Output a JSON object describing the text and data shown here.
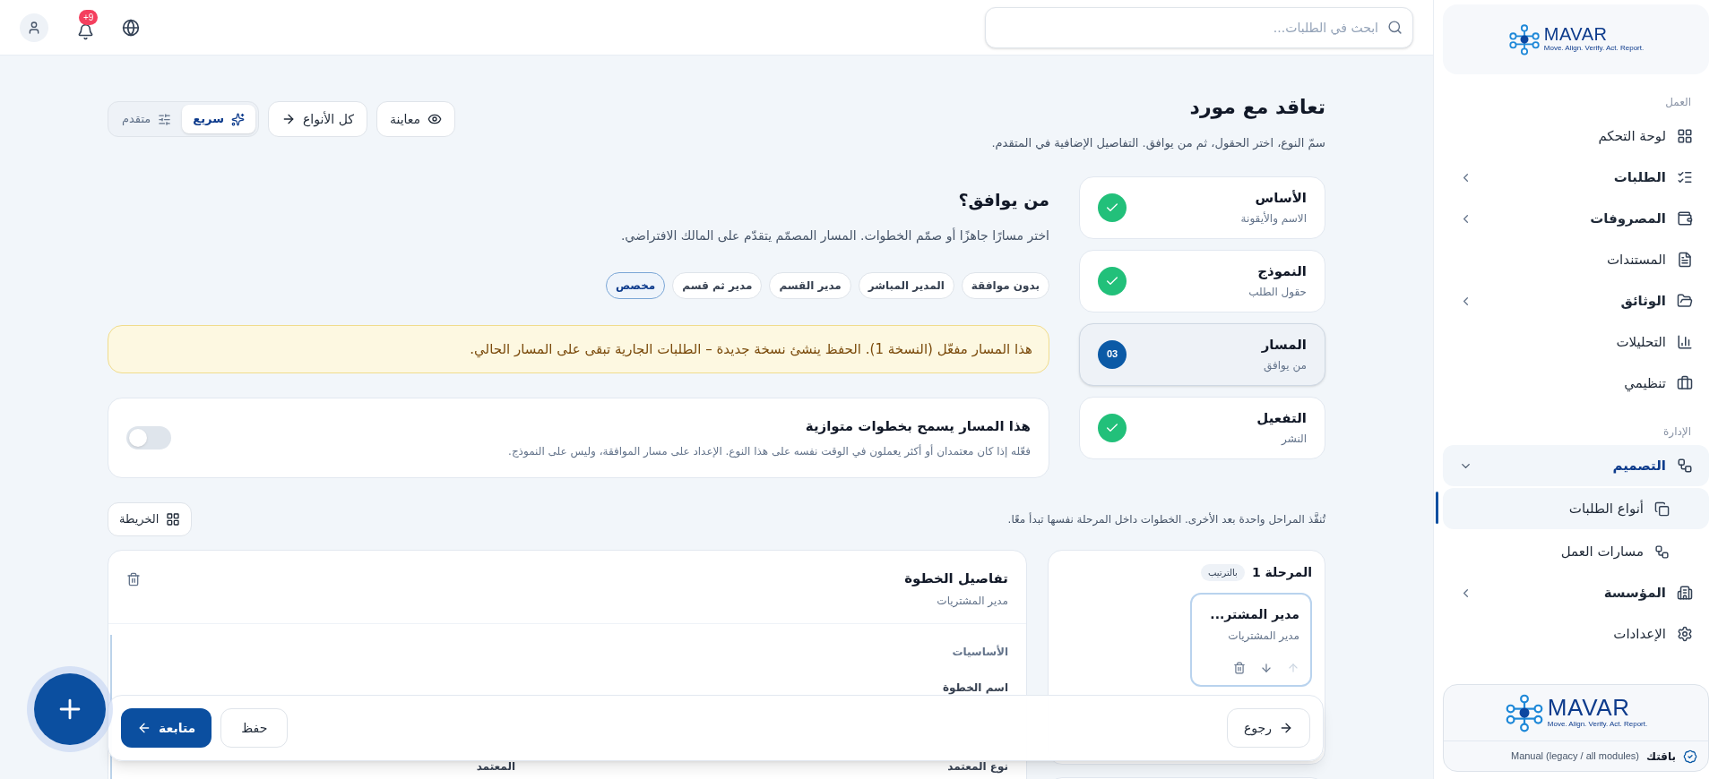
{
  "topbar": {
    "search_placeholder": "ابحث في الطلبات...",
    "notification_count": "+9"
  },
  "page": {
    "title": "تعاقد مع مورد",
    "subtitle": "سمّ النوع، اختر الحقول، ثم من يوافق. التفاصيل الإضافية في المتقدم.",
    "modes": [
      {
        "label": "سريع",
        "selected": true
      },
      {
        "label": "متقدم",
        "selected": false
      }
    ],
    "all_types": "كل الأنواع",
    "preview": "معاينة"
  },
  "steps": [
    {
      "title": "الأساس",
      "subtitle": "الاسم والأيقونة",
      "kind": "done",
      "selected": false
    },
    {
      "title": "النموذج",
      "subtitle": "حقول الطلب",
      "kind": "done",
      "selected": false
    },
    {
      "title": "المسار",
      "subtitle": "من يوافق",
      "kind": "current",
      "number": "03",
      "selected": true
    },
    {
      "title": "التفعيل",
      "subtitle": "النشر",
      "kind": "done",
      "selected": false
    }
  ],
  "approval": {
    "heading": "من يوافق؟",
    "description": "اختر مسارًا جاهزًا أو صمّم الخطوات. المسار المصمّم يتقدّم على المالك الافتراضي.",
    "presets": [
      {
        "label": "بدون موافقة",
        "selected": false
      },
      {
        "label": "المدير المباشر",
        "selected": false
      },
      {
        "label": "مدير القسم",
        "selected": false
      },
      {
        "label": "مدير ثم قسم",
        "selected": false
      },
      {
        "label": "مخصص",
        "selected": true
      }
    ],
    "notice": "هذا المسار مفعّل (النسخة 1). الحفظ ينشئ نسخة جديدة – الطلبات الجارية تبقى على المسار الحالي.",
    "parallel": {
      "title": "هذا المسار يسمح بخطوات متوازية",
      "description": "فعّله إذا كان معتمدان أو أكثر يعملون في الوقت نفسه على هذا النوع. الإعداد على مسار الموافقة، وليس على النموذج.",
      "on": false
    },
    "hint": "تُنفَّذ المراحل واحدة بعد الأخرى. الخطوات داخل المرحلة نفسها تبدأ معًا.",
    "map_button": "الخريطة"
  },
  "stage": {
    "title": "المرحلة 1",
    "badge": "بالترتيب",
    "step": {
      "title": "مدير المشتر...",
      "subtitle": "مدير المشتريات",
      "selected": true
    }
  },
  "step_details": {
    "title": "تفاصيل الخطوة",
    "subtitle": "مدير المشتريات",
    "section": "الأساسيات",
    "field_label": "اسم الخطوة",
    "approver_type": "نوع المعتمد",
    "approver": "المعتمد"
  },
  "footer": {
    "back": "رجوع",
    "save": "حفظ",
    "continue": "متابعة"
  },
  "sidebar": {
    "logo": {
      "name": "MAVAR",
      "tagline": "Move. Align. Verify. Act. Report."
    },
    "sections": [
      {
        "label": "العمل",
        "items": [
          {
            "label": "لوحة التحكم",
            "kind": "link",
            "selected": false
          },
          {
            "label": "الطلبات",
            "kind": "group",
            "expanded": false,
            "selected": false
          },
          {
            "label": "المصروفات",
            "kind": "group",
            "expanded": false,
            "selected": false
          },
          {
            "label": "المستندات",
            "kind": "link",
            "selected": false
          },
          {
            "label": "الوثائق",
            "kind": "group",
            "expanded": false,
            "selected": false
          },
          {
            "label": "التحليلات",
            "kind": "link",
            "selected": false
          },
          {
            "label": "تنظيمي",
            "kind": "link",
            "selected": false
          }
        ]
      },
      {
        "label": "الإدارة",
        "items": [
          {
            "label": "التصميم",
            "kind": "group",
            "expanded": true,
            "selected": false,
            "children": [
              {
                "label": "أنواع الطلبات",
                "selected": true
              },
              {
                "label": "مسارات العمل",
                "selected": false
              }
            ]
          },
          {
            "label": "المؤسسة",
            "kind": "group",
            "expanded": false,
            "selected": false
          },
          {
            "label": "الإعدادات",
            "kind": "link",
            "selected": false
          }
        ]
      }
    ],
    "plan": {
      "logo": {
        "name": "MAVAR",
        "tagline": "Move. Align. Verify. Act. Report."
      },
      "label": "باقتك",
      "value": "Manual (legacy / all modules)"
    }
  }
}
